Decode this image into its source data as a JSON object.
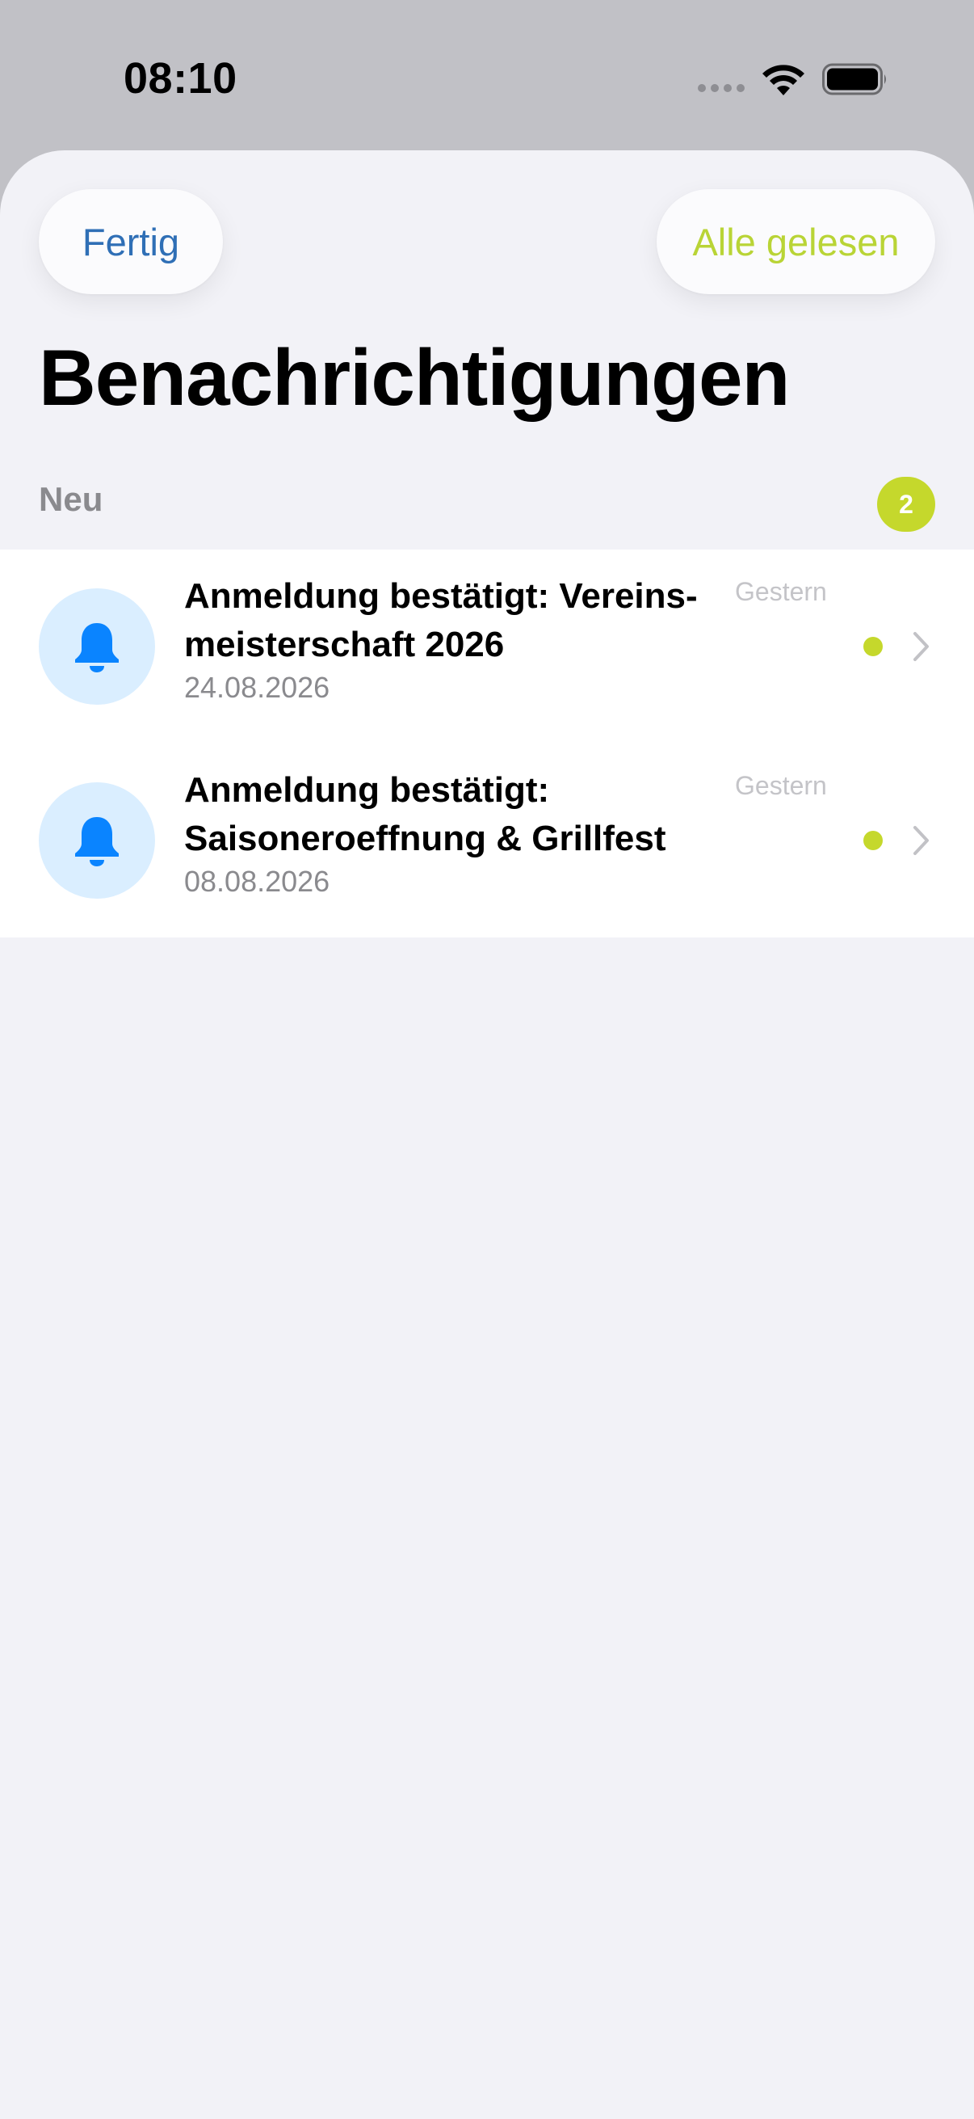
{
  "status_bar": {
    "time": "08:10"
  },
  "header": {
    "done_label": "Fertig",
    "mark_all_read_label": "Alle gelesen",
    "title": "Benachrichtigungen"
  },
  "section": {
    "label": "Neu",
    "count": "2"
  },
  "notifications": [
    {
      "title": "Anmeldung bestätigt: Vereins-meisterschaft 2026",
      "date": "24.08.2026",
      "relative_time": "Gestern",
      "unread": true,
      "icon": "bell-icon"
    },
    {
      "title": "Anmeldung bestätigt: Saisoneroeffnung & Grillfest",
      "date": "08.08.2026",
      "relative_time": "Gestern",
      "unread": true,
      "icon": "bell-icon"
    }
  ],
  "colors": {
    "accent_green": "#c5d82c",
    "link_blue": "#2f6fb6",
    "icon_blue": "#0a84ff",
    "icon_bg": "#daeeff",
    "sheet_bg": "#f2f2f7"
  }
}
